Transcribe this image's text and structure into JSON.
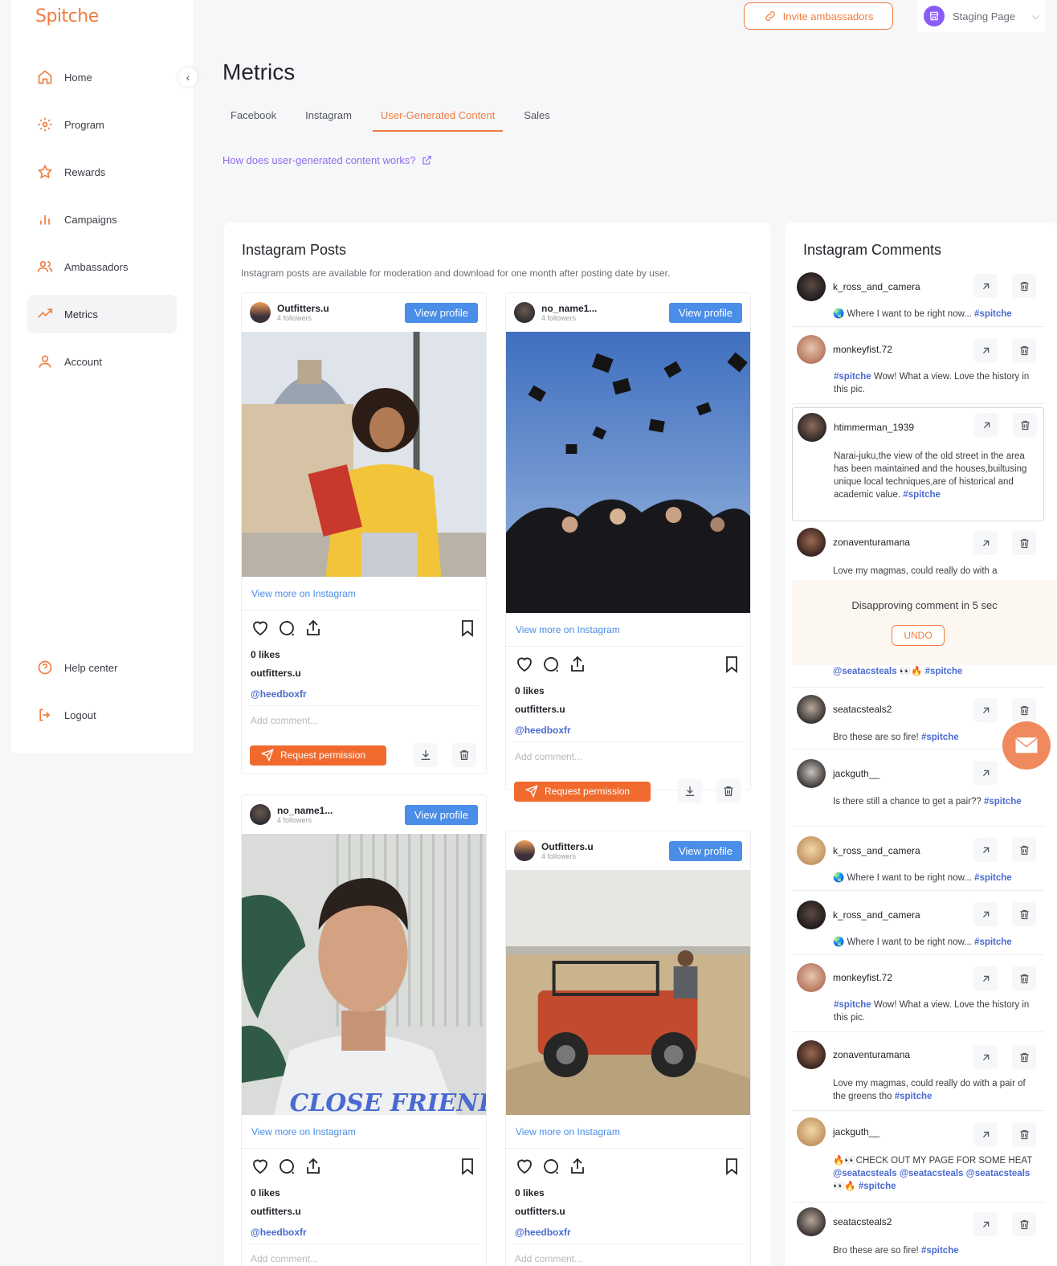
{
  "brand": {
    "logo": "Spitche",
    "accent": "#f07d40"
  },
  "sidebar": {
    "items": [
      {
        "label": "Home",
        "icon": "home-icon"
      },
      {
        "label": "Program",
        "icon": "gear-icon"
      },
      {
        "label": "Rewards",
        "icon": "star-icon"
      },
      {
        "label": "Campaigns",
        "icon": "bar-chart-icon"
      },
      {
        "label": "Ambassadors",
        "icon": "users-icon"
      },
      {
        "label": "Metrics",
        "icon": "trend-icon",
        "active": true
      },
      {
        "label": "Account",
        "icon": "user-icon"
      }
    ],
    "bottom": [
      {
        "label": "Help center",
        "icon": "help-icon"
      },
      {
        "label": "Logout",
        "icon": "logout-icon"
      }
    ]
  },
  "topbar": {
    "invite_label": "Invite ambassadors",
    "page_selector": "Staging Page"
  },
  "page": {
    "title": "Metrics",
    "tabs": [
      "Facebook",
      "Instagram",
      "User-Generated Content",
      "Sales"
    ],
    "active_tab": "User-Generated Content",
    "help_link": "How does user-generated content works?"
  },
  "posts_panel": {
    "title": "Instagram Posts",
    "subtitle": "Instagram posts are available for moderation and download for one month after posting date by user.",
    "view_profile": "View profile",
    "view_more": "View more on Instagram",
    "add_comment": "Add comment...",
    "request_permission": "Request permission",
    "posts": [
      {
        "user": "Outfitters.u",
        "followers": "4 followers",
        "likes": "0 likes",
        "caption_user": "outfitters.u",
        "mention": "@heedboxfr"
      },
      {
        "user": "no_name1...",
        "followers": "4 followers",
        "likes": "0 likes",
        "caption_user": "outfitters.u",
        "mention": "@heedboxfr"
      },
      {
        "user": "no_name1...",
        "followers": "4 followers",
        "likes": "0 likes",
        "caption_user": "outfitters.u",
        "mention": "@heedboxfr"
      },
      {
        "user": "Outfitters.u",
        "followers": "4 followers",
        "likes": "0 likes",
        "caption_user": "outfitters.u",
        "mention": "@heedboxfr"
      }
    ]
  },
  "comments_panel": {
    "title": "Instagram Comments",
    "toast": {
      "text": "Disapproving comment in 5 sec",
      "undo": "UNDO"
    },
    "comments": [
      {
        "user": "k_ross_and_camera",
        "text": "🌏 Where I want to be right now... ",
        "tag": "#spitche"
      },
      {
        "user": "monkeyfist.72",
        "pre_tag": "#spitche",
        "text": " Wow! What a view. Love the history in this pic."
      },
      {
        "user": "htimmerman_1939",
        "text": "Narai-juku,the view of the old street in the area has been maintained and the houses,builtusing unique local techniques,are of historical and academic value. ",
        "tag": "#spitche"
      },
      {
        "user": "zonaventuramana",
        "text": "Love my magmas, could really do with a"
      },
      {
        "user": "",
        "text": "",
        "tag": "@seatacsteals 👀🔥 #spitche"
      },
      {
        "user": "seatacsteals2",
        "text": "Bro these are so fire! ",
        "tag": "#spitche"
      },
      {
        "user": "jackguth__",
        "text": "Is there still a chance to get a pair?? ",
        "tag": "#spitche"
      },
      {
        "user": "k_ross_and_camera",
        "text": "🌏 Where I want to be right now... ",
        "tag": "#spitche"
      },
      {
        "user": "k_ross_and_camera",
        "text": "🌏 Where I want to be right now... ",
        "tag": "#spitche"
      },
      {
        "user": "monkeyfist.72",
        "pre_tag": "#spitche",
        "text": " Wow! What a view. Love the history in this pic."
      },
      {
        "user": "zonaventuramana",
        "text": "Love my magmas, could really do with a pair of the greens tho ",
        "tag": "#spitche"
      },
      {
        "user": "jackguth__",
        "text": "🔥👀CHECK OUT MY PAGE FOR SOME HEAT ",
        "tag": "@seatacsteals @seatacsteals @seatacsteals 👀🔥 #spitche"
      },
      {
        "user": "seatacsteals2",
        "text": "Bro these are so fire! ",
        "tag": "#spitche"
      }
    ]
  }
}
